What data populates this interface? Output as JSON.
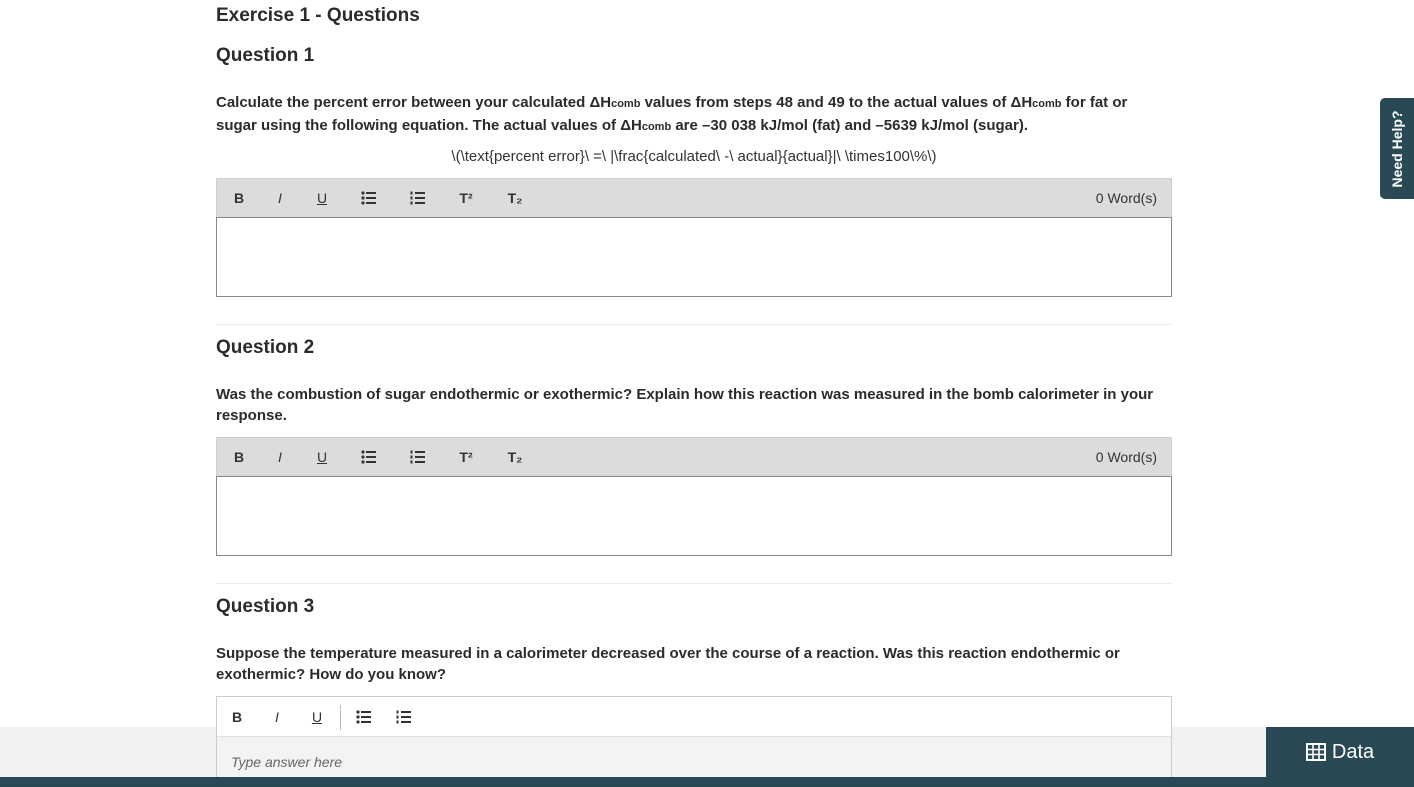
{
  "page": {
    "section_title": "Exercise 1 - Questions"
  },
  "toolbar": {
    "bold": "B",
    "italic": "I",
    "underline": "U",
    "superscript": "T²",
    "subscript": "T₂",
    "word_count": "0  Word(s)"
  },
  "questions": [
    {
      "title": "Question 1",
      "text_parts": {
        "p1": "Calculate the percent error between your calculated ΔH",
        "sub1": "comb",
        "p2": " values from steps 48 and 49 to the actual values of ΔH",
        "sub2": "comb",
        "p3": " for fat or sugar using the following equation. The actual values of ΔH",
        "sub3": "comb",
        "p4": " are –30 038 kJ/mol (fat) and –5639 kJ/mol (sugar)."
      },
      "equation": "\\(\\text{percent error}\\ =\\ |\\frac{calculated\\ -\\ actual}{actual}|\\ \\times100\\%\\)"
    },
    {
      "title": "Question 2",
      "text": "Was the combustion of sugar endothermic or exothermic? Explain how this reaction was measured in the bomb calorimeter in your response."
    },
    {
      "title": "Question 3",
      "text": "Suppose the temperature measured in a calorimeter decreased over the course of a reaction. Was this reaction endothermic or exothermic? How do you know?",
      "placeholder": "Type answer here"
    }
  ],
  "side": {
    "need_help": "Need Help?",
    "data_button": "Data"
  },
  "colors": {
    "accent": "#294a55",
    "toolbar_bg": "#dcdcdc"
  },
  "icons": {
    "bullet_list": "bullet-list-icon",
    "numbered_list": "numbered-list-icon",
    "table": "table-icon"
  }
}
